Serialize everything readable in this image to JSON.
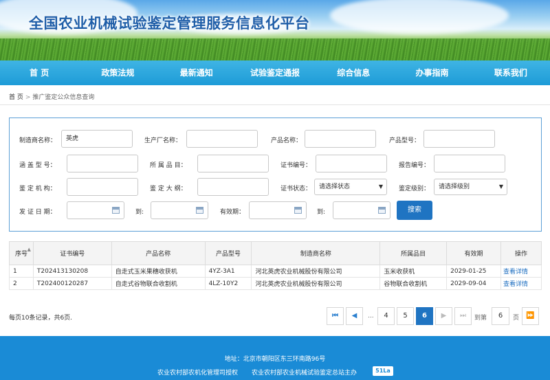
{
  "banner": {
    "title": "全国农业机械试验鉴定管理服务信息化平台"
  },
  "nav": [
    "首 页",
    "政策法规",
    "最新通知",
    "试验鉴定通报",
    "综合信息",
    "办事指南",
    "联系我们"
  ],
  "breadcrumb": {
    "home": "首 页",
    "separator": ">",
    "current": "推广鉴定公众信息查询"
  },
  "search": {
    "manufacturer_label": "制造商名称：",
    "manufacturer_value": "英虎",
    "producer_label": "生产厂名称：",
    "product_name_label": "产品名称：",
    "product_model_label": "产品型号：",
    "coverage_label": "涵 盖 型 号：",
    "category_label": "所 属 品 目：",
    "cert_no_label": "证书编号：",
    "report_no_label": "报告编号：",
    "org_label": "鉴 定 机 构：",
    "outline_label": "鉴 定 大 纲：",
    "cert_status_label": "证书状态：",
    "cert_status_value": "请选择状态",
    "level_label": "鉴定级别：",
    "level_value": "请选择级别",
    "issue_date_label": "发 证 日 期：",
    "to_label_1": "到:",
    "valid_label": "有效期：",
    "to_label_2": "到:",
    "search_button": "搜索"
  },
  "table": {
    "headers": [
      "序号",
      "证书编号",
      "产品名称",
      "产品型号",
      "制造商名称",
      "所属品目",
      "有效期",
      "操作"
    ],
    "rows": [
      [
        "1",
        "T202413130208",
        "自走式玉米果穗收获机",
        "4YZ-3A1",
        "河北英虎农业机械股份有限公司",
        "玉米收获机",
        "2029-01-25",
        "查看详情"
      ],
      [
        "2",
        "T202400120287",
        "自走式谷物联合收割机",
        "4LZ-10Y2",
        "河北英虎农业机械股份有限公司",
        "谷物联合收割机",
        "2029-09-04",
        "查看详情"
      ]
    ]
  },
  "pagination": {
    "summary": "每页10条记录，共6页.",
    "ellipsis": "...",
    "pages": [
      "4",
      "5",
      "6"
    ],
    "current": "6",
    "goto_prefix": "到第",
    "goto_value": "6",
    "goto_suffix": "页"
  },
  "footer": {
    "address": "地址：北京市朝阳区东三环南路96号",
    "authorized": "农业农村部农机化管理司授权",
    "host": "农业农村部农业机械试验鉴定总站主办",
    "badge": "51La"
  },
  "colors": {
    "nav": "#1d9bd7",
    "accent": "#1f74c2",
    "footer": "#1a8bd6",
    "title": "#1f5ea8"
  }
}
